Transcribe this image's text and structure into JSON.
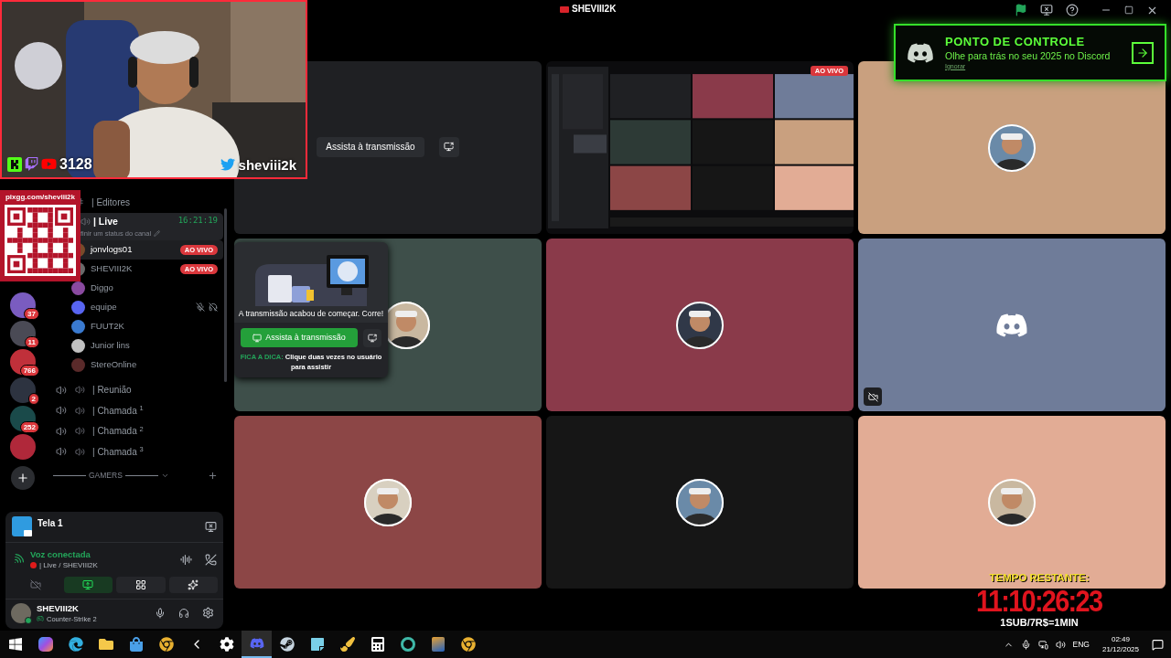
{
  "window": {
    "title": "SHEVIII2K"
  },
  "webcam_overlay": {
    "viewer_count": "3128",
    "handle": "sheviii2k"
  },
  "qr_overlay": {
    "url": "pixgg.com/sheviii2k"
  },
  "checkpoint_banner": {
    "title": "PONTO DE CONTROLE",
    "subtitle": "Olhe para trás no seu 2025 no Discord",
    "dismiss": "Ignorar"
  },
  "servers": [
    {
      "kind": "avatar",
      "badge": "37"
    },
    {
      "kind": "avatar",
      "badge": "11"
    },
    {
      "kind": "avatar",
      "badge": "766"
    },
    {
      "kind": "avatar",
      "badge": "2"
    },
    {
      "kind": "avatar",
      "badge": "252"
    },
    {
      "kind": "avatar"
    }
  ],
  "channels": [
    {
      "kind": "text",
      "name": "| Editores",
      "selected": false
    },
    {
      "kind": "voice",
      "name": "| Live",
      "selected": true,
      "timer": "16:21:19",
      "status": "finir um status do canal",
      "members": [
        {
          "name": "jonvlogs01",
          "badge": "AO VIVO",
          "selected": true,
          "muted": false
        },
        {
          "name": "SHEVIII2K",
          "badge": "AO VIVO",
          "selected": false,
          "muted": false
        },
        {
          "name": "Diggo",
          "selected": false,
          "muted": false
        },
        {
          "name": "equipe",
          "selected": false,
          "muted": true
        },
        {
          "name": "FUUT2K",
          "selected": false,
          "muted": false
        },
        {
          "name": "Junior lins",
          "selected": false,
          "muted": false
        },
        {
          "name": "StereOnline",
          "selected": false,
          "muted": false
        }
      ]
    },
    {
      "kind": "voice",
      "name": "| Reunião",
      "selected": false
    },
    {
      "kind": "voice",
      "name": "| Chamada $^{1}$",
      "selected": false
    },
    {
      "kind": "voice",
      "name": "| Chamada $^{2}$",
      "selected": false
    },
    {
      "kind": "voice",
      "name": "| Chamada $^{3}$",
      "selected": false
    }
  ],
  "category": "GAMERS",
  "stream_panel": {
    "name": "Tela 1"
  },
  "voice_panel": {
    "status": "Voz conectada",
    "channel": "| Live / SHEVIII2K",
    "camera_on": false,
    "screen_share_on": true
  },
  "user_panel": {
    "name": "SHEVIII2K",
    "activity": "Counter-Strike 2"
  },
  "tiles": [
    {
      "kind": "stream",
      "color": "#1f2023",
      "button": "Assista à transmissão"
    },
    {
      "kind": "screen",
      "badge": "AO VIVO"
    },
    {
      "kind": "avatar",
      "color": "#c9a07f"
    },
    {
      "kind": "avatar",
      "color": "#3e4f4a"
    },
    {
      "kind": "avatar",
      "color": "#8a3a4a"
    },
    {
      "kind": "discord",
      "color": "#6f7c99"
    },
    {
      "kind": "avatar",
      "color": "#8c4646"
    },
    {
      "kind": "avatar",
      "color": "#161616"
    },
    {
      "kind": "avatar",
      "color": "#e2ac95"
    }
  ],
  "stream_popup": {
    "message": "A transmissão acabou de começar. Corre!",
    "button": "Assista à transmissão",
    "tip_label": "FICA A DICA:",
    "tip": "Clique duas vezes no usuário para assistir"
  },
  "countdown": {
    "label": "TEMPO RESTANTE:",
    "time": "11:10:26:23",
    "rate": "1SUB/7R$=1MIN"
  },
  "taskbar": {
    "apps": [
      {
        "kind": "start",
        "selected": false
      },
      {
        "kind": "copilot",
        "selected": false
      },
      {
        "kind": "edge",
        "selected": false
      },
      {
        "kind": "files",
        "selected": false
      },
      {
        "kind": "store",
        "selected": false
      },
      {
        "kind": "chrome",
        "selected": false
      },
      {
        "kind": "arrow",
        "selected": false
      },
      {
        "kind": "settings",
        "selected": false
      },
      {
        "kind": "discord",
        "selected": true
      },
      {
        "kind": "steam",
        "selected": false
      },
      {
        "kind": "notes",
        "selected": false
      },
      {
        "kind": "paint",
        "selected": false
      },
      {
        "kind": "calculator",
        "selected": false
      },
      {
        "kind": "ring",
        "selected": false
      },
      {
        "kind": "game",
        "selected": false
      },
      {
        "kind": "chrome",
        "selected": false
      }
    ],
    "language": "ENG",
    "time": "02:49",
    "date": "21/12/2025"
  }
}
